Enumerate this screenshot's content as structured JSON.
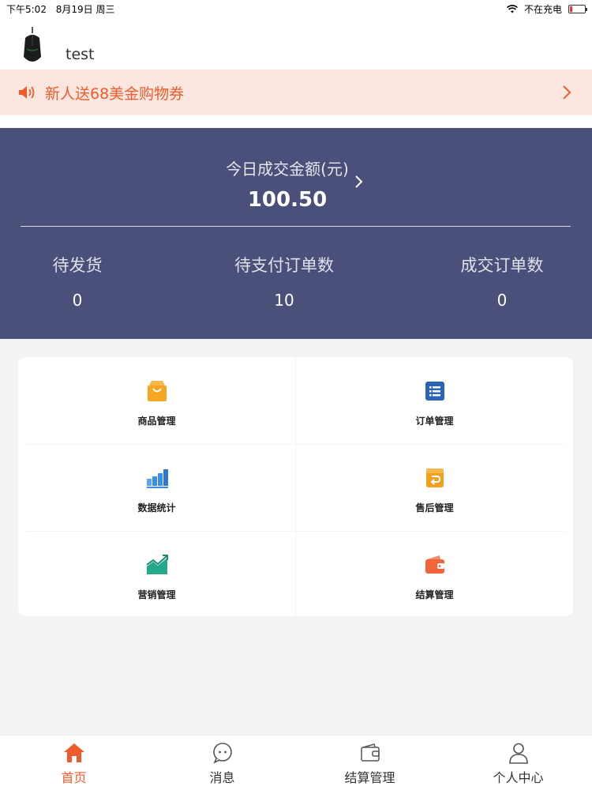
{
  "status_bar": {
    "time": "下午5:02",
    "date": "8月19日 周三",
    "charging": "不在充电"
  },
  "store": {
    "name": "test",
    "avatar_icon": "mouse-icon"
  },
  "promo": {
    "text": "新人送68美金购物券",
    "color": "#ef5b2b"
  },
  "stats": {
    "today_label": "今日成交金额(元)",
    "today_amount": "100.50",
    "items": [
      {
        "label": "待发货",
        "value": "0"
      },
      {
        "label": "待支付订单数",
        "value": "10"
      },
      {
        "label": "成交订单数",
        "value": "0"
      }
    ],
    "panel_color": "#4a5079"
  },
  "menu": [
    {
      "label": "商品管理",
      "icon": "shopping-bag-icon",
      "color": "#f5a623"
    },
    {
      "label": "订单管理",
      "icon": "order-list-icon",
      "color": "#2a63b8"
    },
    {
      "label": "数据统计",
      "icon": "bar-chart-icon",
      "color": "#3b8ee6"
    },
    {
      "label": "售后管理",
      "icon": "after-sales-icon",
      "color": "#f0a21e"
    },
    {
      "label": "营销管理",
      "icon": "trend-chart-icon",
      "color": "#26a88a"
    },
    {
      "label": "结算管理",
      "icon": "wallet-icon",
      "color": "#f2643a"
    }
  ],
  "tabs": [
    {
      "label": "首页",
      "icon": "home-icon",
      "active": true
    },
    {
      "label": "消息",
      "icon": "message-icon",
      "active": false
    },
    {
      "label": "结算管理",
      "icon": "wallet-icon",
      "active": false
    },
    {
      "label": "个人中心",
      "icon": "user-icon",
      "active": false
    }
  ]
}
